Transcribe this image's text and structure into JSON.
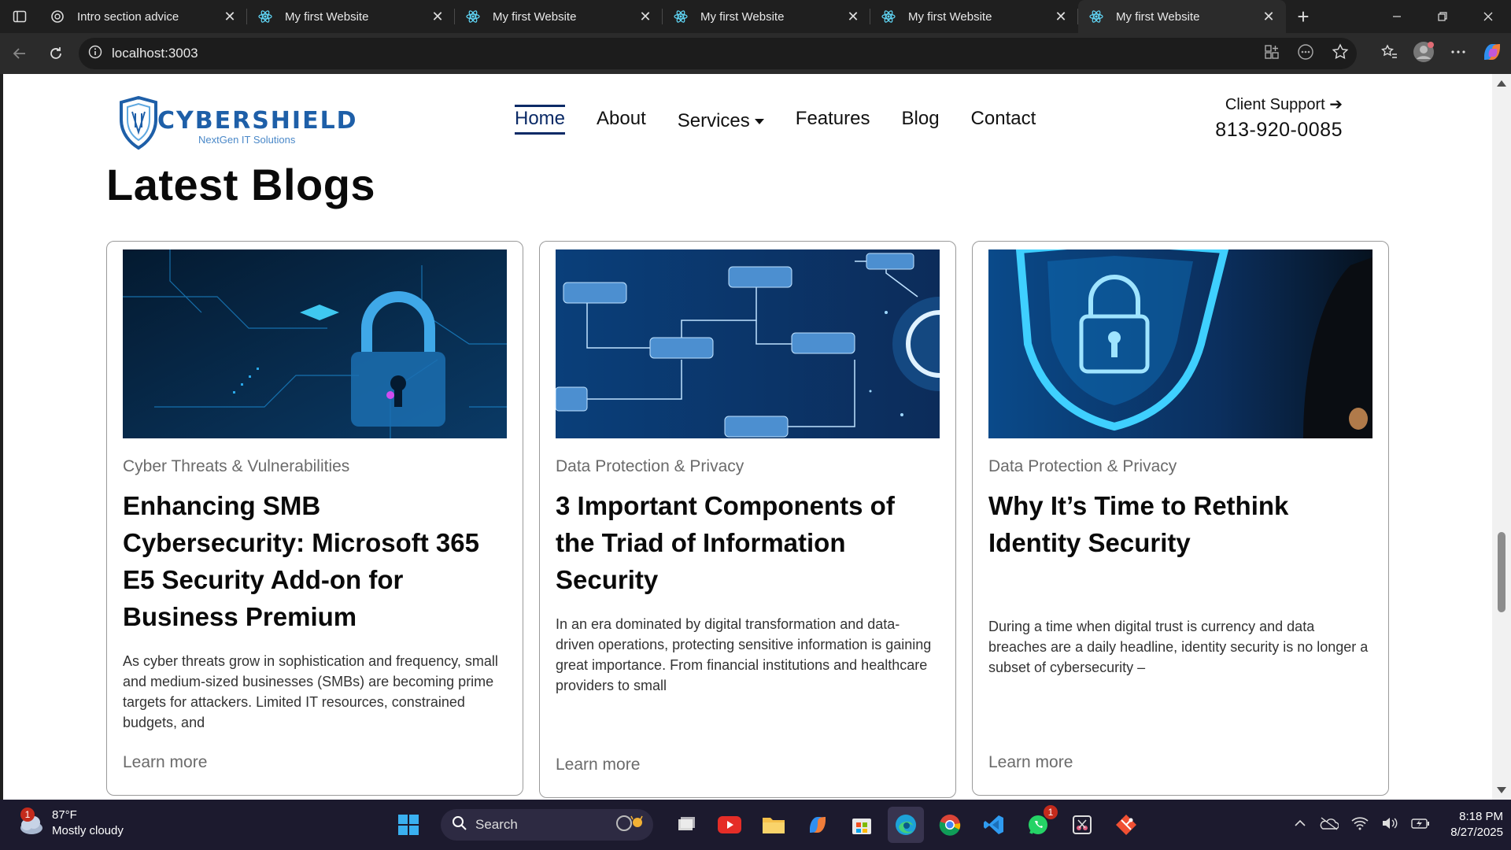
{
  "browser": {
    "tabs": [
      {
        "title": "Intro section advice",
        "icon": "chatgpt-icon"
      },
      {
        "title": "My first Website",
        "icon": "react-icon"
      },
      {
        "title": "My first Website",
        "icon": "react-icon"
      },
      {
        "title": "My first Website",
        "icon": "react-icon"
      },
      {
        "title": "My first Website",
        "icon": "react-icon"
      },
      {
        "title": "My first Website",
        "icon": "react-icon",
        "active": true
      }
    ],
    "url": "localhost:3003"
  },
  "site": {
    "logo_text": "CYBERSHIELD",
    "logo_tagline": "NextGen IT Solutions",
    "nav": {
      "home": "Home",
      "about": "About",
      "services": "Services",
      "features": "Features",
      "blog": "Blog",
      "contact": "Contact"
    },
    "support_label": "Client Support",
    "support_phone": "813-920-0085"
  },
  "blogs": {
    "heading": "Latest Blogs",
    "cards": [
      {
        "category": "Cyber Threats & Vulnerabilities",
        "title": "Enhancing SMB Cybersecurity: Microsoft 365 E5 Security Add-on for Business Premium",
        "excerpt": "As cyber threats grow in sophistication and frequency, small and medium-sized businesses (SMBs) are becoming prime targets for attackers. Limited IT resources, constrained budgets, and",
        "link": "Learn more"
      },
      {
        "category": "Data Protection & Privacy",
        "title": "3 Important Components of the Triad of Information Security",
        "excerpt": "In an era dominated by digital transformation and data-driven operations, protecting sensitive information is gaining great importance. From financial institutions and healthcare providers to small",
        "link": "Learn more"
      },
      {
        "category": "Data Protection & Privacy",
        "title": "Why It’s Time to Rethink Identity Security",
        "excerpt": "During a time when digital trust is currency and data breaches are a daily headline, identity security is no longer a subset of cybersecurity –",
        "link": "Learn more"
      }
    ]
  },
  "taskbar": {
    "weather_temp": "87°F",
    "weather_desc": "Mostly cloudy",
    "weather_badge": "1",
    "search_label": "Search",
    "whatsapp_badge": "1",
    "time": "8:18 PM",
    "date": "8/27/2025"
  },
  "colors": {
    "nav_active": "#0b2a66",
    "logo_blue": "#1e5fa8",
    "card_border": "#9a9a9a"
  }
}
